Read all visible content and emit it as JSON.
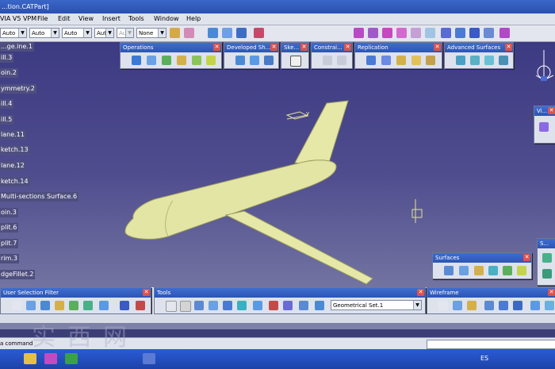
{
  "window": {
    "title": "...tion.CATPart]"
  },
  "menu": [
    "VIA V5 VPM",
    "File",
    "Edit",
    "View",
    "Insert",
    "Tools",
    "Window",
    "Help"
  ],
  "toolbar": {
    "combos": [
      "Auto",
      "Auto",
      "Auto",
      "Aut",
      "Aut",
      "None"
    ]
  },
  "tree": {
    "items": [
      "...ge.ine.1",
      "ill.3",
      "oin.2",
      "ymmetry.2",
      "ill.4",
      "ill.5",
      "lane.11",
      "ketch.13",
      "lane.12",
      "ketch.14",
      "Multi-sections Surface.6",
      "oin.3",
      "plit.6",
      "plit.7",
      "rim.3",
      "dgeFillet.2"
    ]
  },
  "panels": {
    "operations": "Operations",
    "developed": "Developed Sh...",
    "sketch": "Ske...",
    "constraint": "Constrai...",
    "replication": "Replication",
    "advanced": "Advanced Surfaces",
    "vi": "Vi...",
    "s": "S...",
    "surfaces": "Surfaces",
    "user_selection": "User Selection Filter",
    "tools": "Tools",
    "wireframe": "Wireframe"
  },
  "tools": {
    "geometrical_set": "Geometrical Set.1"
  },
  "status": {
    "command_prompt": "a command"
  },
  "taskbar": {
    "lang": "ES"
  },
  "watermark": [
    "实",
    "西",
    "网"
  ],
  "axis": {
    "z": "z",
    "y": "y",
    "x": "x"
  },
  "colors": {
    "viewport_top": "#3c3a82",
    "viewport_bottom": "#7f82a8",
    "aircraft": "#e6e8a8",
    "panel_header": "#2c55b5"
  }
}
